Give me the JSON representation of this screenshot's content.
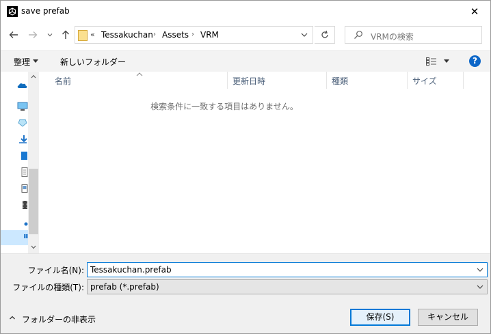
{
  "window": {
    "title": "save prefab",
    "close_glyph": "✕"
  },
  "address": {
    "overflow": "«",
    "breadcrumbs": [
      "Tessakuchan",
      "Assets",
      "VRM"
    ],
    "separator": "›"
  },
  "search": {
    "placeholder": "VRMの検索"
  },
  "toolbar": {
    "organize_label": "整理",
    "new_folder_label": "新しいフォルダー",
    "help_glyph": "?"
  },
  "columns": [
    {
      "label": "名前"
    },
    {
      "label": "更新日時"
    },
    {
      "label": "種類"
    },
    {
      "label": "サイズ"
    }
  ],
  "file_list": {
    "empty_message": "検索条件に一致する項目はありません。"
  },
  "form": {
    "filename_label": "ファイル名(N):",
    "filename_value": "Tessakuchan.prefab",
    "filetype_label": "ファイルの種類(T):",
    "filetype_value": "prefab (*.prefab)"
  },
  "footer": {
    "hide_folders_label": "フォルダーの非表示",
    "save_label": "保存(S)",
    "cancel_label": "キャンセル"
  },
  "colors": {
    "accent": "#0078d7",
    "help": "#0c66c8",
    "column_header_text": "#4c607a",
    "panel_bg": "#f0f0f0"
  }
}
